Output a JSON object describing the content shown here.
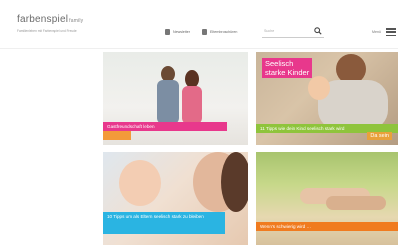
{
  "header": {
    "logo": "farbenspiel",
    "logo_small": "family",
    "tagline": "Familienleben mit Farbenspiel und Freude",
    "links": [
      {
        "icon": "newspaper-icon",
        "label": "Newsletter"
      },
      {
        "icon": "booklet-icon",
        "label": "Elternbroschüren"
      }
    ],
    "search_placeholder": "Suche",
    "menu_label": "Menü"
  },
  "tiles": [
    {
      "label": "Gastfreundschaft leben",
      "bar_color": "#e8388c"
    },
    {
      "badge_line1": "Seelisch",
      "badge_line2": "starke Kinder",
      "label": "11 Tipps wie dein Kind seelisch stark wird",
      "side_text": "Da sein",
      "bar_color": "#8fc43c"
    },
    {
      "label": "10 Tipps um als Eltern seelisch stark zu bleiben",
      "bar_color": "#2ab4e2"
    },
    {
      "label": "Wenn's schwierig wird …",
      "bar_color": "#f07b1f"
    }
  ]
}
